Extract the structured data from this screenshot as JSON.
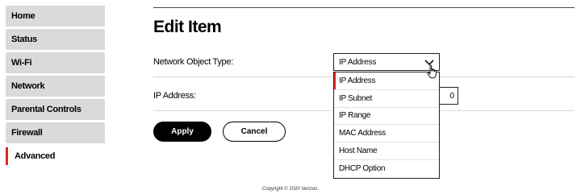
{
  "sidebar": {
    "items": [
      {
        "label": "Home"
      },
      {
        "label": "Status"
      },
      {
        "label": "Wi-Fi"
      },
      {
        "label": "Network"
      },
      {
        "label": "Parental Controls"
      },
      {
        "label": "Firewall"
      },
      {
        "label": "Advanced",
        "active": true
      }
    ]
  },
  "page": {
    "title": "Edit Item"
  },
  "form": {
    "network_object_type_label": "Network Object Type:",
    "network_object_type_value": "IP Address",
    "ip_address_label": "IP Address:",
    "ip_address_value": "",
    "ip_address_partial_visible": "0"
  },
  "dropdown": {
    "options": [
      "IP Address",
      "IP Subnet",
      "IP Range",
      "MAC Address",
      "Host Name",
      "DHCP Option"
    ],
    "selected": "IP Address"
  },
  "buttons": {
    "apply": "Apply",
    "cancel": "Cancel"
  },
  "footer": {
    "copyright": "Copyright © 2020 Verizon."
  },
  "colors": {
    "accent": "#d52b1e",
    "sidebar_bg": "#d8dadb"
  }
}
